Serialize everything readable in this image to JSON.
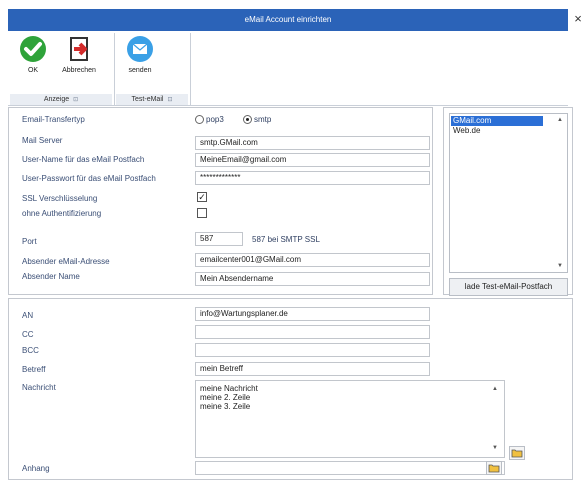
{
  "window": {
    "title": "eMail Account einrichten",
    "close_glyph": "×"
  },
  "ribbon": {
    "ok_label": "OK",
    "cancel_label": "Abbrechen",
    "send_label": "senden",
    "group1_label": "Anzeige",
    "group2_label": "Test-eMail",
    "launcher_glyph": "⊡"
  },
  "account": {
    "transfer_type_label": "Email-Transfertyp",
    "pop3_label": "pop3",
    "smtp_label": "smtp",
    "selected_transfer": "smtp",
    "mail_server_label": "Mail Server",
    "mail_server_value": "smtp.GMail.com",
    "username_label": "User-Name für das eMail Postfach",
    "username_value": "MeineEmail@gmail.com",
    "password_label": "User-Passwort für das eMail Postfach",
    "password_value": "*************",
    "ssl_label": "SSL Verschlüsselung",
    "ssl_checked": true,
    "noauth_label": "ohne Authentifizierung",
    "noauth_checked": false,
    "port_label": "Port",
    "port_value": "587",
    "port_hint": "587 bei SMTP SSL",
    "sender_address_label": "Absender eMail-Adresse",
    "sender_address_value": "emailcenter001@GMail.com",
    "sender_name_label": "Absender Name",
    "sender_name_value": "Mein Absendername"
  },
  "provider_list": {
    "items": [
      "GMail.com",
      "Web.de"
    ],
    "selected_index": 0,
    "load_button_label": "lade Test-eMail-Postfach"
  },
  "message": {
    "to_label": "AN",
    "to_value": "info@Wartungsplaner.de",
    "cc_label": "CC",
    "cc_value": "",
    "bcc_label": "BCC",
    "bcc_value": "",
    "subject_label": "Betreff",
    "subject_value": "mein Betreff",
    "body_label": "Nachricht",
    "body_lines": [
      "meine Nachricht",
      "meine 2. Zeile",
      "meine 3. Zeile"
    ],
    "attachment_label": "Anhang",
    "attachment_value": ""
  }
}
